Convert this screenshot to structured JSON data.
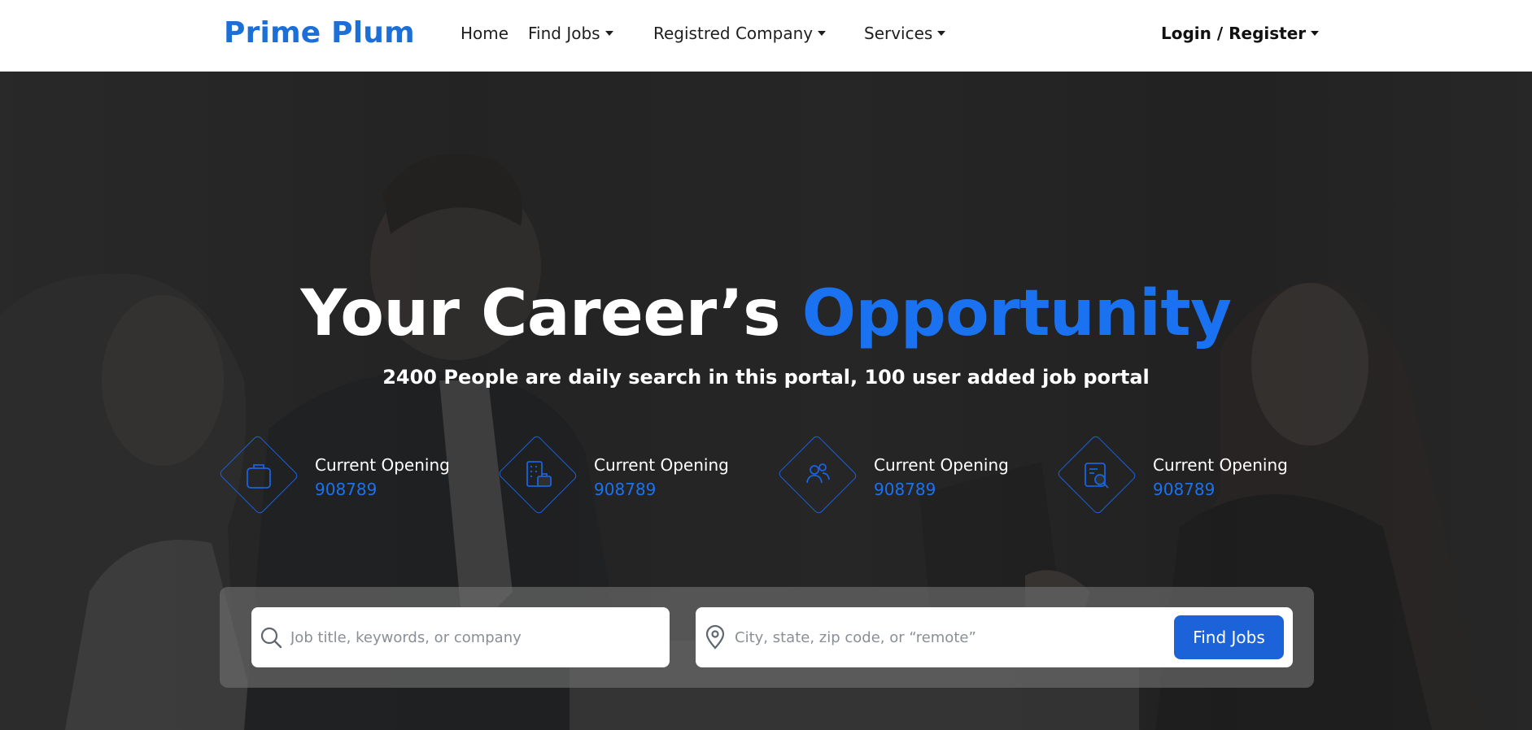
{
  "brand": "Prime Plum",
  "nav": {
    "home": "Home",
    "find_jobs": "Find Jobs",
    "registered_company": "Registred Company",
    "services": "Services",
    "login": "Login / Register"
  },
  "hero": {
    "headline_main": "Your Career’s ",
    "headline_accent": "Opportunity",
    "subline": "2400 People are daily search in this portal, 100 user added job portal"
  },
  "stats": [
    {
      "icon": "briefcase-icon",
      "label": "Current Opening",
      "value": "908789"
    },
    {
      "icon": "building-briefcase-icon",
      "label": "Current Opening",
      "value": "908789"
    },
    {
      "icon": "users-icon",
      "label": "Current Opening",
      "value": "908789"
    },
    {
      "icon": "document-search-icon",
      "label": "Current Opening",
      "value": "908789"
    }
  ],
  "search": {
    "keyword_placeholder": "Job title, keywords, or company",
    "location_placeholder": "City, state, zip code, or “remote”",
    "button": "Find Jobs"
  },
  "colors": {
    "brand": "#1d6fd8",
    "accent": "#1a72f0",
    "button": "#1c62d8"
  }
}
